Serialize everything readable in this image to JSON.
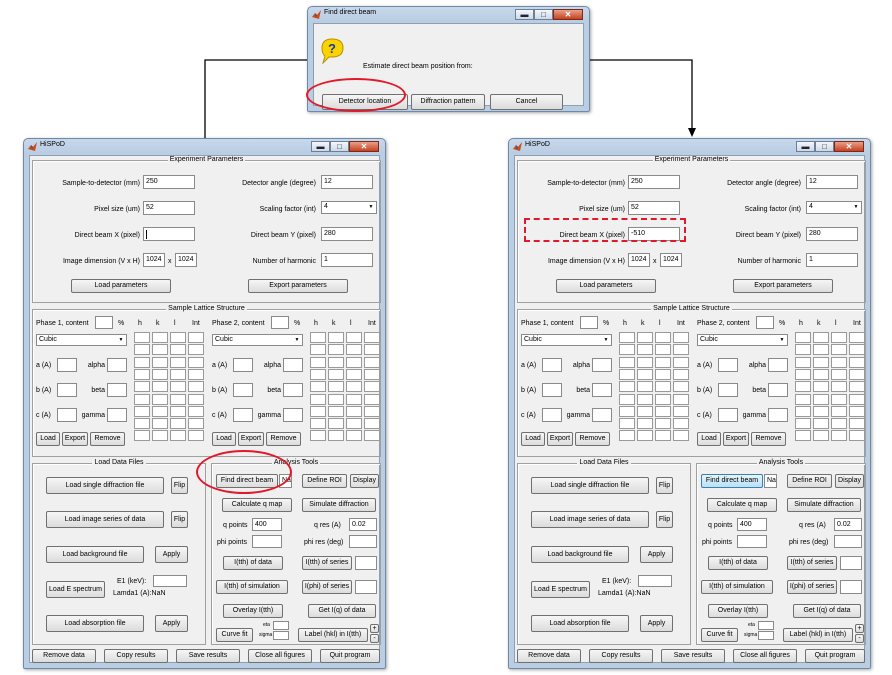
{
  "dialog": {
    "title": "Find direct beam",
    "message": "Estimate direct beam position from:",
    "buttons": [
      "Detector location",
      "Diffraction pattern",
      "Cancel"
    ]
  },
  "window": {
    "title": "HiSPoD",
    "controls": [
      "minimize-icon",
      "maximize-icon",
      "close-icon"
    ],
    "experiment": {
      "title": "Experiment Parameters",
      "left": [
        {
          "label": "Sample-to-detector (mm)",
          "value": "250"
        },
        {
          "label": "Pixel size (um)",
          "value": "52"
        },
        {
          "label": "Direct beam X (pixel)",
          "value": ""
        },
        {
          "label": "Image dimension (V x H)",
          "value": "1024",
          "value2": "1024",
          "sep": "x"
        }
      ],
      "right": [
        {
          "label": "Detector angle (degree)",
          "value": "12"
        },
        {
          "label": "Scaling factor (int)",
          "value": "4"
        },
        {
          "label": "Direct beam Y (pixel)",
          "value": "280"
        },
        {
          "label": "Number of harmonic",
          "value": "1"
        }
      ],
      "load": "Load parameters",
      "export": "Export parameters"
    },
    "lattice": {
      "title": "Sample Lattice Structure",
      "phases": [
        {
          "title": "Phase 1,  content",
          "pct": "%",
          "system": "Cubic"
        },
        {
          "title": "Phase 2,  content",
          "pct": "%",
          "system": "Cubic"
        }
      ],
      "hkl": [
        "h",
        "k",
        "l",
        "Int"
      ],
      "params": [
        {
          "a": "a (A)",
          "b": "alpha"
        },
        {
          "a": "b (A)",
          "b": "beta"
        },
        {
          "a": "c (A)",
          "b": "gamma"
        }
      ],
      "buttons": [
        "Load",
        "Export",
        "Remove"
      ]
    },
    "data_files": {
      "title": "Load Data Files",
      "single": "Load single diffraction file",
      "flip": "Flip",
      "series": "Load image series of data",
      "background": "Load background file",
      "apply": "Apply",
      "espectrum": "Load E spectrum",
      "e1": "E1 (keV):",
      "lamda": "Lamda1 (A):NaN",
      "absorption": "Load absorption file"
    },
    "analysis": {
      "title": "Analysis Tools",
      "find_beam": "Find direct beam",
      "na": "Na",
      "define_roi": "Define ROI",
      "display": "Display",
      "calc_q": "Calculate q map",
      "simulate": "Simulate diffraction",
      "q_points": "q points",
      "q_points_val": "400",
      "q_res": "q res (A)",
      "q_res_val": "0.02",
      "phi_points": "phi points",
      "phi_res": "phi res (deg)",
      "i_tth_data": "I(tth) of data",
      "i_tth_series": "I(tth) of series",
      "i_tth_sim": "I(tth) of simulation",
      "i_phi_series": "I(phi) of series",
      "overlay": "Overlay I(tth)",
      "get_iq": "Get I(q) of data",
      "curve_fit": "Curve fit",
      "eta": "eta",
      "sigma": "sigma",
      "label_hkl": "Label (hkl) in I(tth)",
      "plus": "+",
      "minus": "-"
    },
    "bottom": [
      "Remove data",
      "Copy results",
      "Save results",
      "Close all figures",
      "Quit program"
    ]
  },
  "after": {
    "direct_beam_x": "-510"
  },
  "colors": {
    "highlight": "#e01a2b",
    "bg": "#f0f0f0"
  }
}
